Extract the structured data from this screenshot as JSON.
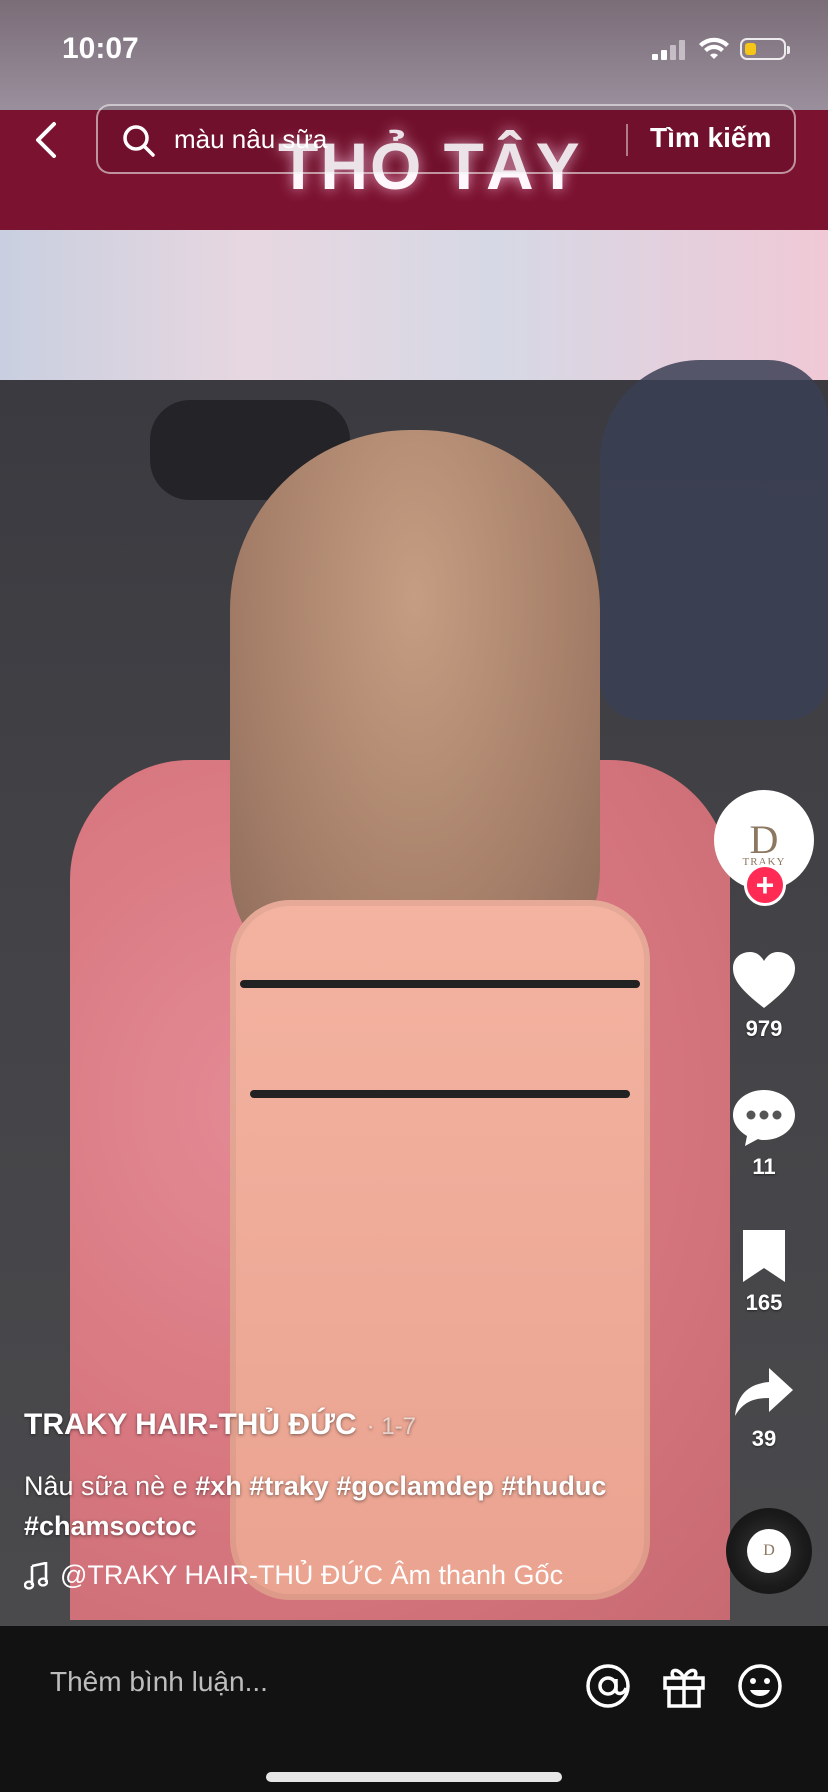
{
  "status_bar": {
    "time": "10:07",
    "battery_level": 0.3,
    "battery_color": "#f5c518"
  },
  "search": {
    "query": "màu nâu sữa",
    "submit_label": "Tìm kiếm",
    "back_icon": "chevron-left-icon",
    "search_icon": "magnifier-icon"
  },
  "video": {
    "storefront_sign": "THỎ TÂY"
  },
  "creator": {
    "avatar_logo": "TRAKY",
    "follow_icon": "plus-icon",
    "follow_color": "#ff2b55"
  },
  "actions": {
    "likes": {
      "icon": "heart-icon",
      "count": "979"
    },
    "comments": {
      "icon": "comment-bubble-icon",
      "count": "11"
    },
    "saves": {
      "icon": "bookmark-icon",
      "count": "165"
    },
    "shares": {
      "icon": "share-arrow-icon",
      "count": "39"
    }
  },
  "caption": {
    "author": "TRAKY HAIR-THỦ ĐỨC",
    "date": "· 1-7",
    "text": "Nâu sữa nè e",
    "hashtags": [
      "#xh",
      "#traky",
      "#goclamdep",
      "#thuduc",
      "#chamsoctoc"
    ]
  },
  "music": {
    "icon": "music-note-icon",
    "text": "@TRAKY HAIR-THỦ ĐỨC Âm thanh Gốc"
  },
  "bottom_bar": {
    "comment_placeholder": "Thêm bình luận...",
    "mention_icon": "at-sign-icon",
    "gift_icon": "gift-icon",
    "emoji_icon": "smiley-icon"
  }
}
